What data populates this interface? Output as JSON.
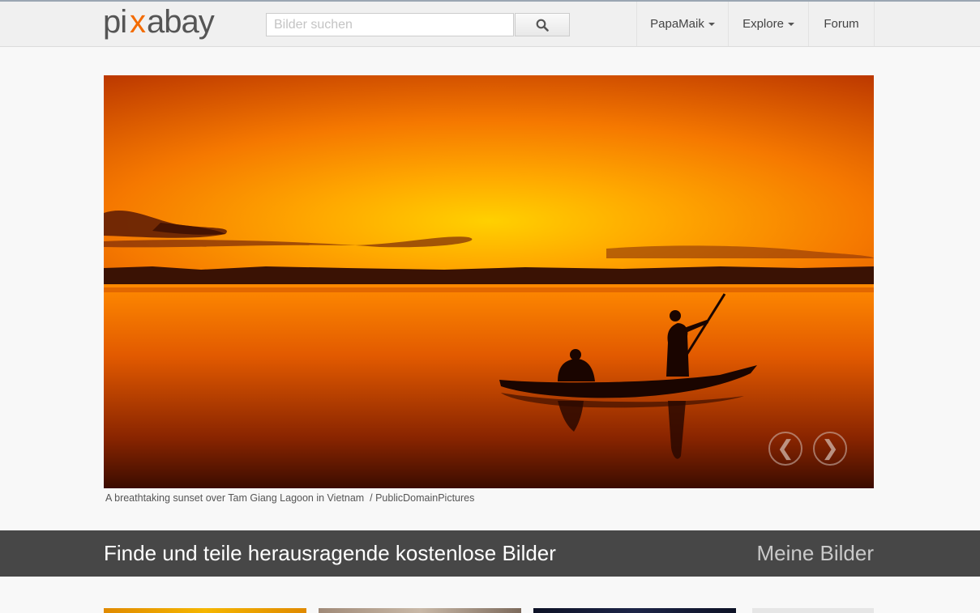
{
  "header": {
    "logo_text": "pixabay",
    "search_placeholder": "Bilder suchen",
    "search_icon": "search-icon",
    "nav": {
      "user": "PapaMaik",
      "explore": "Explore",
      "forum": "Forum"
    }
  },
  "hero": {
    "caption": "A breathtaking sunset over Tam Giang Lagoon in Vietnam  / PublicDomainPictures",
    "prev_label": "❮",
    "next_label": "❯"
  },
  "band": {
    "title": "Finde und teile herausragende kostenlose Bilder",
    "my_images": "Meine Bilder"
  },
  "colors": {
    "logo_gray": "#555555",
    "logo_accent": "#f36b00",
    "band_bg": "#474747"
  }
}
